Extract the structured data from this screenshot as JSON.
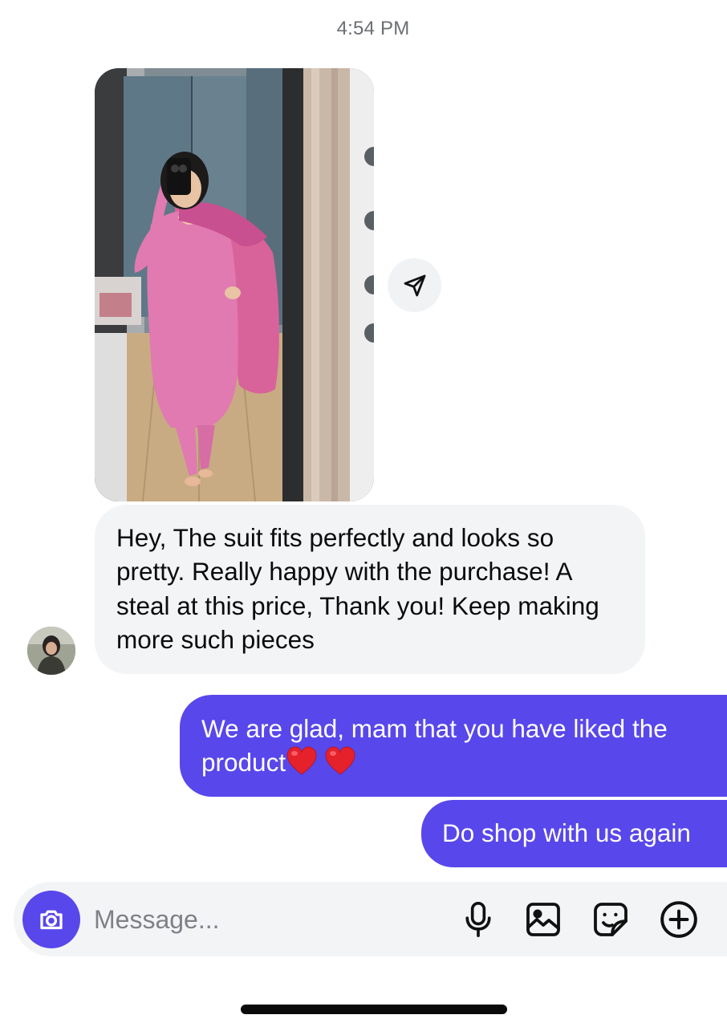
{
  "thread": {
    "timestamp": "4:54 PM"
  },
  "messages": {
    "incoming_photo": {
      "alt": "Customer mirror selfie wearing a pink suit with dupatta",
      "share_icon": "paper-plane-icon"
    },
    "incoming_text": "Hey, The suit fits perfectly and looks so pretty. Really happy with the purchase! A steal at this price, Thank you! Keep making more such pieces",
    "outgoing_1_text": "We are glad, mam that you have liked the product",
    "outgoing_1_emoji": "❤️ ❤️",
    "outgoing_2_text": "Do shop with us again",
    "avatar_icon": "user-avatar"
  },
  "composer": {
    "placeholder": "Message...",
    "value": "",
    "camera_icon": "camera-icon",
    "mic_icon": "microphone-icon",
    "gallery_icon": "image-icon",
    "sticker_icon": "sticker-icon",
    "more_icon": "plus-circle-icon"
  },
  "colors": {
    "accent": "#5847eb",
    "incoming_bubble": "#f3f4f6",
    "timestamp": "#6b6e73"
  }
}
